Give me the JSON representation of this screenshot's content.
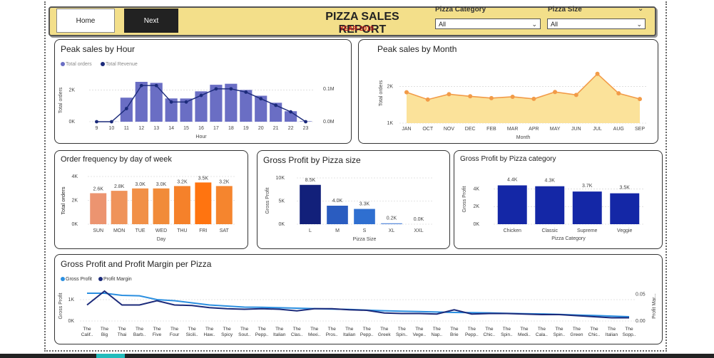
{
  "header": {
    "home_label": "Home",
    "next_label": "Next",
    "title": "PIZZA SALES REPORT",
    "subtitle": "YEAR-2015",
    "category_filter": {
      "label": "Pizza Category",
      "value": "All"
    },
    "size_filter": {
      "label": "Pizza Size",
      "value": "All"
    }
  },
  "colors": {
    "header_bg": "#f3df8a",
    "bar_purple": "#6a6ec4",
    "line_navy": "#1b2a7a",
    "orange_line": "#f29b48",
    "area_fill": "#fbe29a",
    "accent_red": "#c0141c"
  },
  "chart_data": [
    {
      "id": "hour",
      "type": "bar",
      "title": "Peak sales by Hour",
      "legend": [
        "Total orders",
        "Total Revenue"
      ],
      "legend_placement": "top-left",
      "xlabel": "Hour",
      "ylabel": "Total orders",
      "categories": [
        "9",
        "10",
        "11",
        "12",
        "13",
        "14",
        "15",
        "16",
        "17",
        "18",
        "19",
        "20",
        "21",
        "22",
        "23"
      ],
      "series": [
        {
          "name": "Total orders",
          "values": [
            1,
            8,
            1520,
            2520,
            2455,
            1472,
            1468,
            1920,
            2336,
            2399,
            2009,
            1642,
            1198,
            663,
            28
          ]
        },
        {
          "name": "Total Revenue",
          "values": [
            0.0,
            0.0,
            0.04,
            0.11,
            0.11,
            0.06,
            0.06,
            0.08,
            0.1,
            0.1,
            0.09,
            0.07,
            0.05,
            0.03,
            0.0
          ]
        }
      ],
      "y_ticks": [
        "0K",
        "2K"
      ],
      "y2_ticks": [
        "0.0M",
        "0.1M"
      ],
      "ylim": [
        0,
        2700
      ],
      "y2lim": [
        0,
        0.13
      ]
    },
    {
      "id": "month",
      "type": "area",
      "title": "Peak sales by Month",
      "xlabel": "Month",
      "ylabel": "Total orders",
      "categories": [
        "JAN",
        "OCT",
        "NOV",
        "DEC",
        "FEB",
        "MAR",
        "APR",
        "MAY",
        "JUN",
        "JUL",
        "AUG",
        "SEP"
      ],
      "values": [
        1845,
        1646,
        1792,
        1735,
        1685,
        1721,
        1664,
        1853,
        1773,
        2350,
        1815,
        1661
      ],
      "y_ticks": [
        "1K",
        "2K"
      ],
      "ylim": [
        1000,
        2500
      ]
    },
    {
      "id": "day",
      "type": "bar",
      "title": "Order frequency by day of week",
      "xlabel": "Day",
      "ylabel": "Total orders",
      "categories": [
        "SUN",
        "MON",
        "TUE",
        "WED",
        "THU",
        "FRI",
        "SAT"
      ],
      "values": [
        2.6,
        2.8,
        3.0,
        3.0,
        3.2,
        3.5,
        3.2
      ],
      "data_labels": [
        "2.6K",
        "2.8K",
        "3.0K",
        "3.0K",
        "3.2K",
        "3.5K",
        "3.2K"
      ],
      "bar_colors": [
        "#ec9470",
        "#ef935a",
        "#f19047",
        "#f18b39",
        "#f5812a",
        "#ff7410",
        "#f5852e"
      ],
      "y_ticks": [
        "0K",
        "2K",
        "4K"
      ],
      "ylim": [
        0,
        4
      ]
    },
    {
      "id": "size",
      "type": "bar",
      "title": "Gross Profit by Pizza size",
      "xlabel": "Pizza Size",
      "ylabel": "Gross Profit",
      "categories": [
        "L",
        "M",
        "S",
        "XL",
        "XXL"
      ],
      "values": [
        8.5,
        4.0,
        3.3,
        0.2,
        0.0
      ],
      "data_labels": [
        "8.5K",
        "4.0K",
        "3.3K",
        "0.2K",
        "0.0K"
      ],
      "bar_colors": [
        "#12207a",
        "#2a5cc0",
        "#2f6fd0",
        "#5f8fdd",
        "#6f9ae0"
      ],
      "y_ticks": [
        "0K",
        "5K",
        "10K"
      ],
      "ylim": [
        0,
        10
      ]
    },
    {
      "id": "category",
      "type": "bar",
      "title": "Gross Profit by Pizza category",
      "xlabel": "Pizza Category",
      "ylabel": "Gross Profit",
      "categories": [
        "Chicken",
        "Classic",
        "Supreme",
        "Veggie"
      ],
      "values": [
        4.4,
        4.3,
        3.7,
        3.5
      ],
      "data_labels": [
        "4.4K",
        "4.3K",
        "3.7K",
        "3.5K"
      ],
      "y_ticks": [
        "0K",
        "2K",
        "4K"
      ],
      "ylim": [
        0,
        5
      ]
    },
    {
      "id": "pizza",
      "type": "line",
      "title": "Gross Profit and Profit Margin per Pizza",
      "legend": [
        "Gross Profit",
        "Profit Margin"
      ],
      "legend_placement": "top-left",
      "ylabel": "Gross Profit",
      "y2label": "Profit Mar...",
      "categories": [
        "The Calif..",
        "The Big",
        "The Thai",
        "The Barb..",
        "The Five",
        "The Four",
        "The Sicili..",
        "The Haw..",
        "The Spicy",
        "The Sout..",
        "The Pepp..",
        "The Italian",
        "The Clas..",
        "The Mexi..",
        "The Pros..",
        "The Italian",
        "The Pepp..",
        "The Greek",
        "The Spin..",
        "The Vege..",
        "The Nap..",
        "The Brie",
        "The Pepp..",
        "The Chic..",
        "The Spin..",
        "The Medi..",
        "The Cala..",
        "The Spin..",
        "The Green",
        "The Chic..",
        "The Italian",
        "The Sopp.."
      ],
      "series": [
        {
          "name": "Gross Profit",
          "values": [
            1300,
            1300,
            1200,
            1180,
            1000,
            950,
            850,
            750,
            700,
            650,
            640,
            620,
            600,
            580,
            560,
            540,
            510,
            480,
            460,
            440,
            420,
            400,
            390,
            380,
            360,
            340,
            330,
            310,
            280,
            260,
            230,
            200
          ]
        },
        {
          "name": "Profit Margin",
          "values": [
            0.03,
            0.056,
            0.03,
            0.03,
            0.038,
            0.03,
            0.029,
            0.025,
            0.023,
            0.022,
            0.023,
            0.022,
            0.019,
            0.023,
            0.023,
            0.021,
            0.02,
            0.015,
            0.014,
            0.014,
            0.013,
            0.021,
            0.013,
            0.014,
            0.014,
            0.013,
            0.012,
            0.012,
            0.01,
            0.008,
            0.006,
            0.006
          ]
        }
      ],
      "y_ticks": [
        "0K",
        "1K"
      ],
      "y2_ticks": [
        "0.00",
        "0.05"
      ],
      "ylim": [
        0,
        1500
      ],
      "y2lim": [
        0,
        0.06
      ]
    }
  ]
}
